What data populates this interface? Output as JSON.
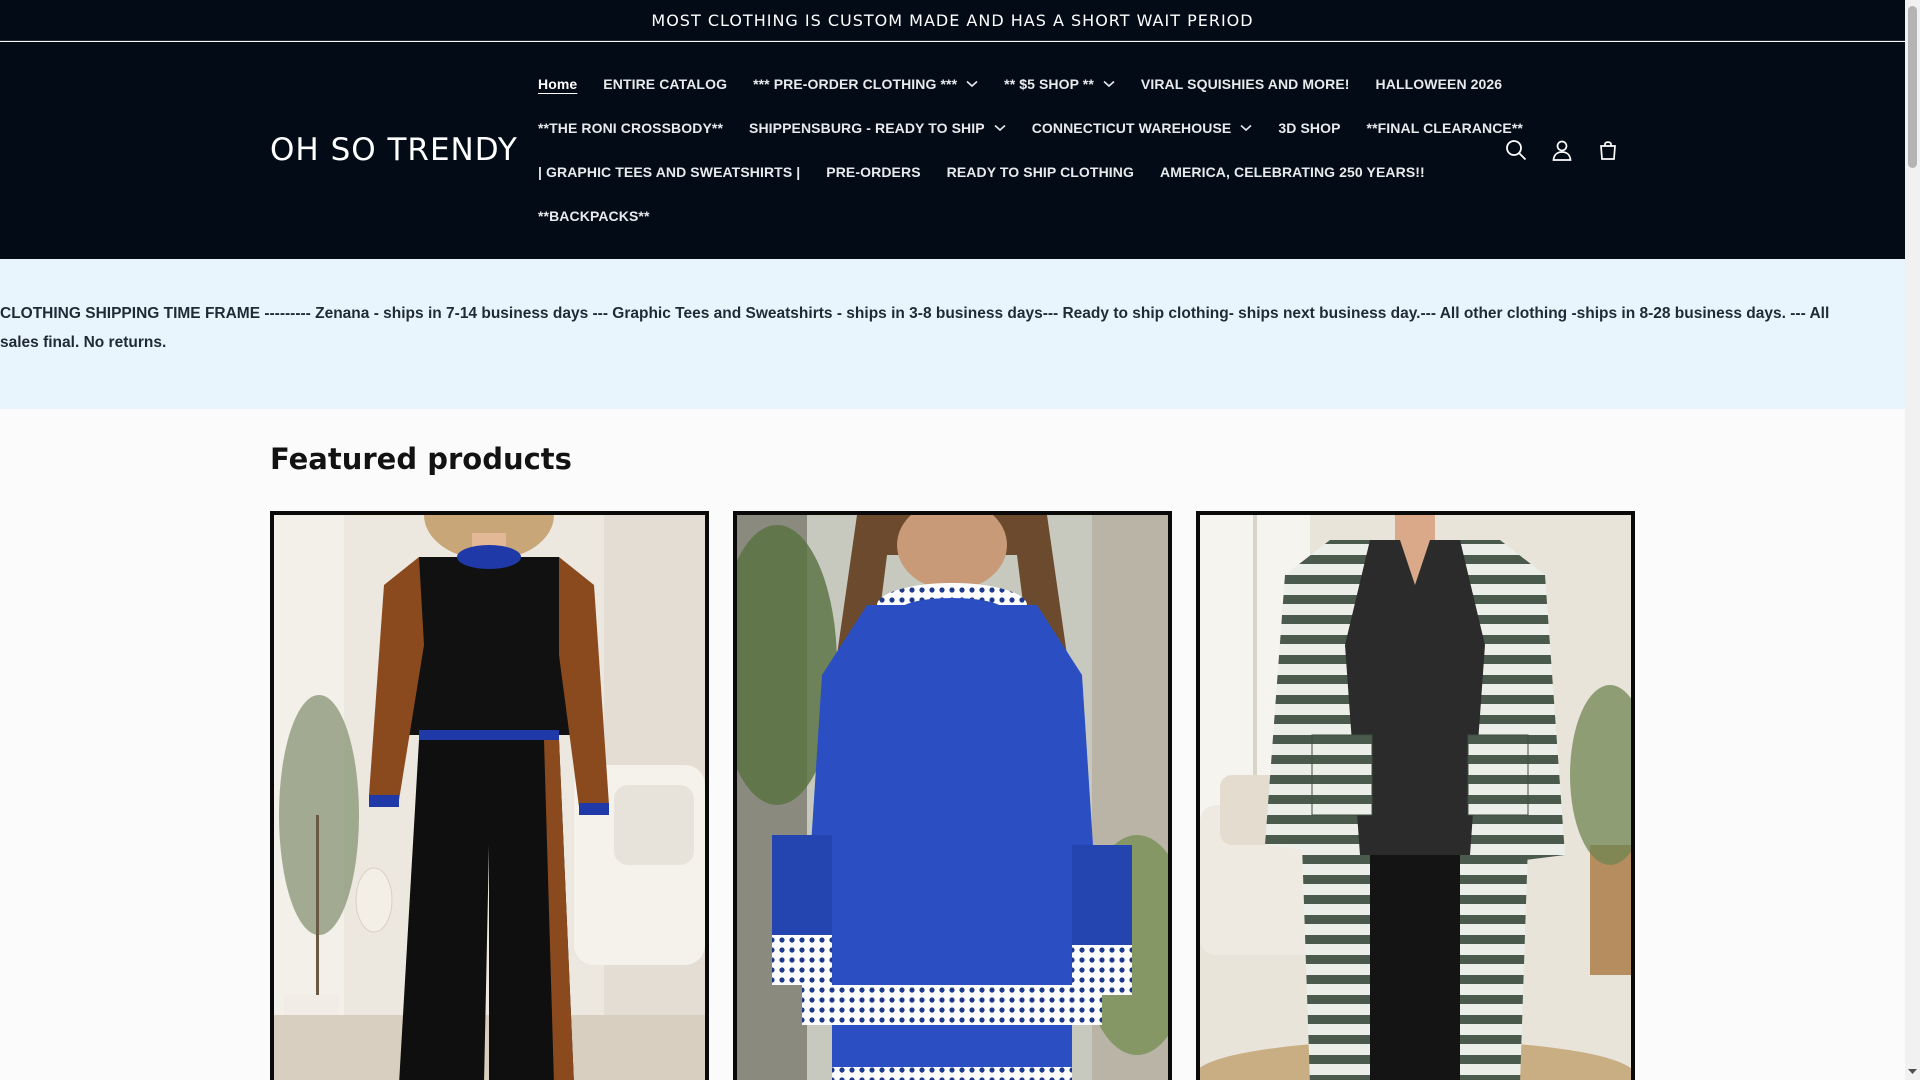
{
  "announcement": {
    "text": "MOST CLOTHING IS CUSTOM MADE AND HAS A SHORT WAIT PERIOD"
  },
  "header": {
    "logo": "OH SO TRENDY",
    "nav_rows": [
      [
        {
          "label": "Home",
          "active": true,
          "dropdown": false
        },
        {
          "label": "ENTIRE CATALOG",
          "dropdown": false
        },
        {
          "label": "*** PRE-ORDER CLOTHING ***",
          "dropdown": true
        },
        {
          "label": "** $5 SHOP **",
          "dropdown": true
        },
        {
          "label": "VIRAL SQUISHIES AND MORE!",
          "dropdown": false
        },
        {
          "label": "HALLOWEEN 2026",
          "dropdown": false
        }
      ],
      [
        {
          "label": "**THE RONI CROSSBODY**",
          "dropdown": false
        },
        {
          "label": "SHIPPENSBURG - READY TO SHIP",
          "dropdown": true
        },
        {
          "label": "CONNECTICUT WAREHOUSE",
          "dropdown": true
        },
        {
          "label": "3D SHOP",
          "dropdown": false
        },
        {
          "label": "**FINAL CLEARANCE**",
          "dropdown": false
        }
      ],
      [
        {
          "label": "| GRAPHIC TEES AND SWEATSHIRTS |",
          "dropdown": false
        },
        {
          "label": "PRE-ORDERS",
          "dropdown": false
        },
        {
          "label": "READY TO SHIP CLOTHING",
          "dropdown": false
        },
        {
          "label": "AMERICA, CELEBRATING 250 YEARS!!",
          "dropdown": false
        }
      ],
      [
        {
          "label": "**BACKPACKS**",
          "dropdown": false
        }
      ]
    ],
    "icons": [
      "search-icon",
      "account-icon",
      "cart-icon"
    ]
  },
  "shipping_banner": {
    "text": "CLOTHING SHIPPING TIME FRAME --------- Zenana - ships in 7-14 business days --- Graphic Tees and Sweatshirts - ships in 3-8 business days--- Ready to ship clothing- ships next business day.--- All other clothing -ships in 8-28 business days. --- All sales final. No returns."
  },
  "featured": {
    "title": "Featured products",
    "products": [
      {
        "image": "black-rust-colorblock-loungewear-set"
      },
      {
        "image": "blue-polka-dot-trim-sweatshirt-set"
      },
      {
        "image": "striped-long-cardigan"
      }
    ]
  },
  "colors": {
    "header_bg": "#020b16",
    "banner_bg": "#e9f5fc",
    "page_bg": "#fbfbfb"
  }
}
